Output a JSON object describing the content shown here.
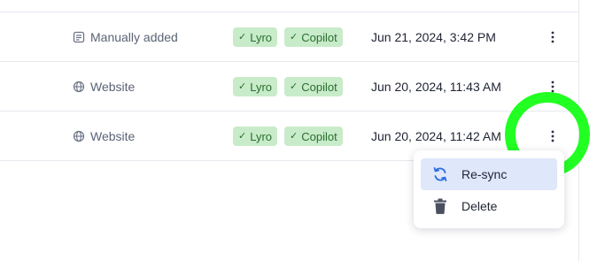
{
  "rows": [
    {
      "source": {
        "label": "Manually added",
        "icon": "note-icon"
      },
      "badges": [
        "Lyro",
        "Copilot"
      ],
      "date": "Jun 21, 2024, 3:42 PM"
    },
    {
      "source": {
        "label": "Website",
        "icon": "globe-icon"
      },
      "badges": [
        "Lyro",
        "Copilot"
      ],
      "date": "Jun 20, 2024, 11:43 AM"
    },
    {
      "source": {
        "label": "Website",
        "icon": "globe-icon"
      },
      "badges": [
        "Lyro",
        "Copilot"
      ],
      "date": "Jun 20, 2024, 11:42 AM"
    }
  ],
  "badge_check": "✓",
  "menu": {
    "items": [
      {
        "label": "Re-sync",
        "icon": "resync-icon",
        "active": true
      },
      {
        "label": "Delete",
        "icon": "trash-icon",
        "active": false
      }
    ]
  },
  "colors": {
    "badge_bg": "#c8ebc9",
    "badge_text": "#2a6e2f",
    "menu_active_bg": "#dfe7fb",
    "resync_icon": "#2d6cdf",
    "highlight_ring": "#22ff22"
  }
}
